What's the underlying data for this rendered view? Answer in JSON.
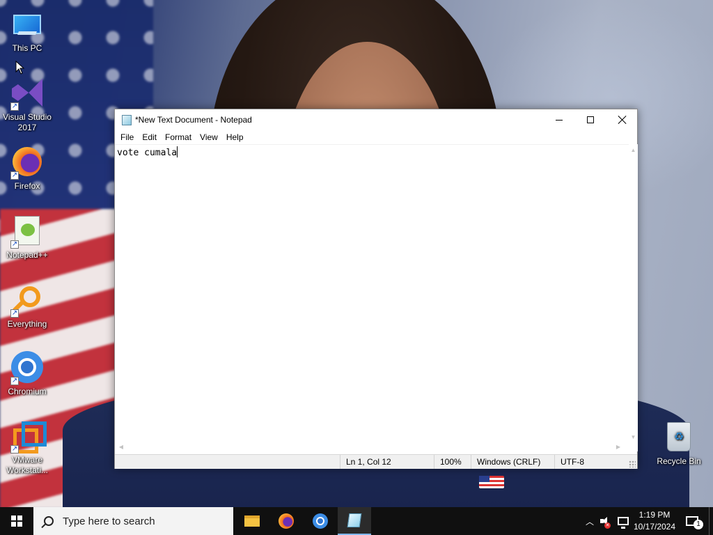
{
  "desktop": {
    "icons": [
      {
        "label": "This PC",
        "icon": "this-pc-icon"
      },
      {
        "label": "Visual Studio 2017",
        "icon": "visual-studio-icon"
      },
      {
        "label": "Firefox",
        "icon": "firefox-icon"
      },
      {
        "label": "Notepad++",
        "icon": "notepad-plus-plus-icon"
      },
      {
        "label": "Everything",
        "icon": "everything-search-icon"
      },
      {
        "label": "Chromium",
        "icon": "chromium-icon"
      },
      {
        "label": "VMware Workstati...",
        "icon": "vmware-icon"
      },
      {
        "label": "Recycle Bin",
        "icon": "recycle-bin-icon"
      }
    ]
  },
  "notepad": {
    "title": "*New Text Document - Notepad",
    "menu": [
      "File",
      "Edit",
      "Format",
      "View",
      "Help"
    ],
    "content": "vote cumala",
    "status": {
      "position": "Ln 1, Col 12",
      "zoom": "100%",
      "line_endings": "Windows (CRLF)",
      "encoding": "UTF-8"
    }
  },
  "taskbar": {
    "search_placeholder": "Type here to search",
    "apps": [
      "file-explorer",
      "firefox",
      "chromium",
      "notepad"
    ],
    "active_app": "notepad",
    "clock": {
      "time": "1:19 PM",
      "date": "10/17/2024"
    },
    "notification_count": "1"
  },
  "colors": {
    "taskbar_bg": "#101010",
    "active_indicator": "#7fb7ee",
    "statusbar_bg": "#f0f0f0"
  }
}
